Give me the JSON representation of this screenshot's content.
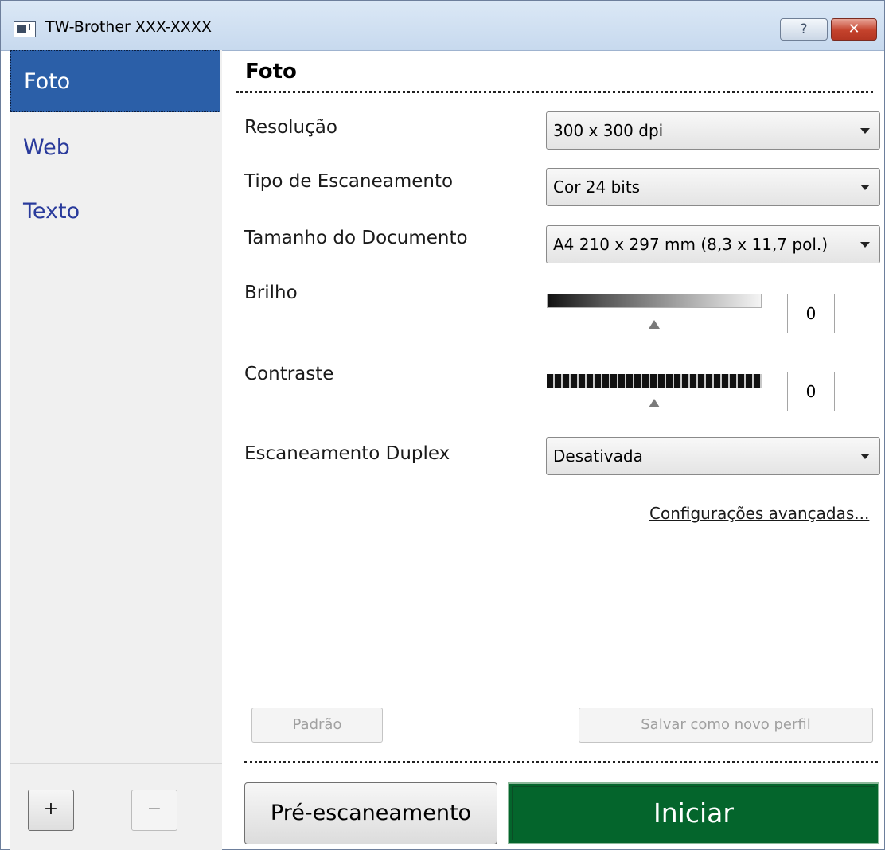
{
  "window": {
    "title": "TW-Brother XXX-XXXX",
    "help_label": "?",
    "close_label": "✕"
  },
  "sidebar": {
    "items": [
      {
        "label": "Foto",
        "selected": true
      },
      {
        "label": "Web",
        "selected": false
      },
      {
        "label": "Texto",
        "selected": false
      }
    ],
    "add_label": "+",
    "remove_label": "−"
  },
  "main": {
    "section_title": "Foto",
    "resolution": {
      "label": "Resolução",
      "value": "300 x 300 dpi"
    },
    "scan_type": {
      "label": "Tipo de Escaneamento",
      "value": "Cor 24 bits"
    },
    "doc_size": {
      "label": "Tamanho do Documento",
      "value": "A4 210 x 297 mm (8,3 x 11,7 pol.)"
    },
    "brightness": {
      "label": "Brilho",
      "value": "0"
    },
    "contrast": {
      "label": "Contraste",
      "value": "0"
    },
    "duplex": {
      "label": "Escaneamento Duplex",
      "value": "Desativada"
    },
    "advanced_link": "Configurações avançadas...",
    "default_button": "Padrão",
    "save_profile_button": "Salvar como novo perfil",
    "prescan_button": "Pré-escaneamento",
    "start_button": "Iniciar"
  },
  "colors": {
    "selected_item_bg": "#2b5fa8",
    "sidebar_link_text": "#2a3b9c",
    "start_button_bg": "#04652c",
    "close_button_bg": "#c4422c"
  }
}
